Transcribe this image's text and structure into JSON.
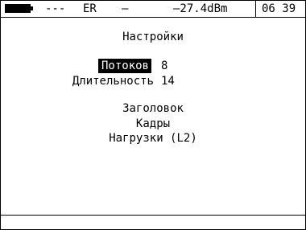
{
  "status": {
    "dashes": "---",
    "mode": "ER",
    "separator": "–",
    "level": "–27.4dBm",
    "time": "06 39"
  },
  "settings": {
    "title": "Настройки",
    "params": [
      {
        "label": "Потоков",
        "value": "8"
      },
      {
        "label": "Длительность",
        "value": "14"
      }
    ],
    "menu": [
      "Заголовок",
      "Кадры",
      "Нагрузки (L2)"
    ]
  }
}
